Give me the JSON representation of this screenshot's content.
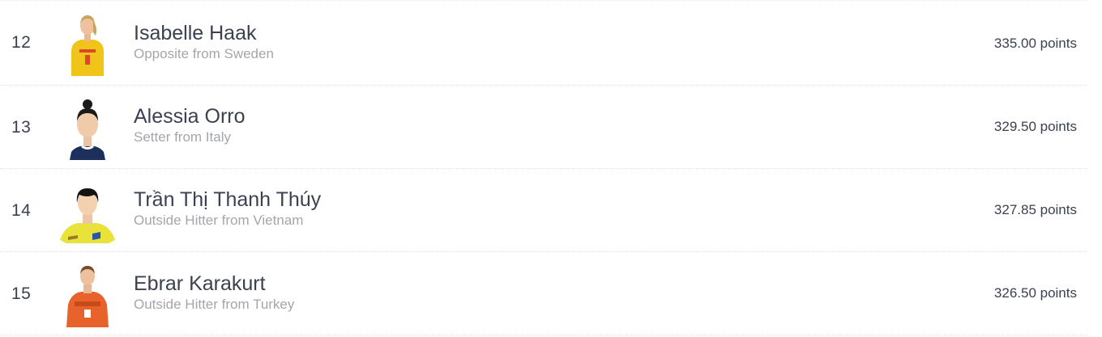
{
  "players": [
    {
      "rank": "12",
      "name": "Isabelle Haak",
      "subtitle": "Opposite from Sweden",
      "points": "335.00 points",
      "jersey_color": "#f0c419",
      "accent_color": "#d94a2b"
    },
    {
      "rank": "13",
      "name": "Alessia Orro",
      "subtitle": "Setter from Italy",
      "points": "329.50 points",
      "jersey_color": "#1d2f5c",
      "accent_color": "#ffffff"
    },
    {
      "rank": "14",
      "name": "Trần Thị Thanh Thúy",
      "subtitle": "Outside Hitter from Vietnam",
      "points": "327.85 points",
      "jersey_color": "#e8e23a",
      "accent_color": "#2a56a3"
    },
    {
      "rank": "15",
      "name": "Ebrar Karakurt",
      "subtitle": "Outside Hitter from Turkey",
      "points": "326.50 points",
      "jersey_color": "#e8622c",
      "accent_color": "#ffffff"
    }
  ]
}
